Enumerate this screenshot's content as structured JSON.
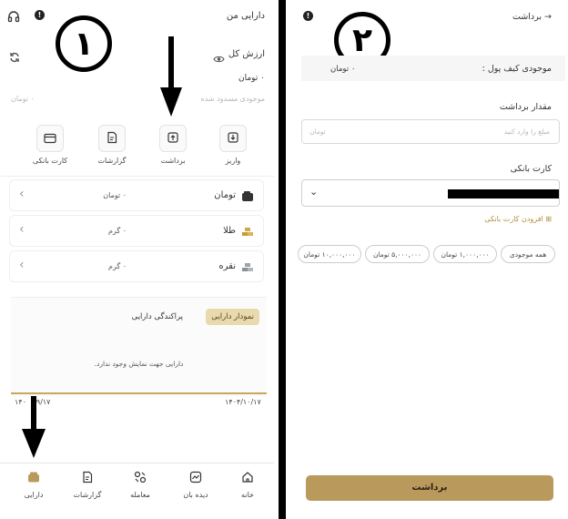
{
  "left": {
    "header_title": "دارایی من",
    "total_label": "ارزش کل",
    "total_value": "۰ تومان",
    "blocked_label": "موجودی مسدود شده",
    "blocked_value": "۰ تومان",
    "actions": [
      {
        "label": "واریز",
        "icon": "download-icon"
      },
      {
        "label": "برداشت",
        "icon": "upload-icon"
      },
      {
        "label": "گزارشات",
        "icon": "report-icon"
      },
      {
        "label": "کارت بانکی",
        "icon": "bank-card-icon"
      }
    ],
    "assets": [
      {
        "name": "تومان",
        "value": "۰ تومان",
        "icon": "wallet-icon"
      },
      {
        "name": "طلا",
        "value": "۰ گرم",
        "icon": "gold-icon"
      },
      {
        "name": "نقره",
        "value": "۰ گرم",
        "icon": "silver-icon"
      }
    ],
    "chart_tab_active": "نمودار دارایی",
    "chart_tab": "پراکندگی دارایی",
    "chart_empty": "دارایی جهت نمایش وجود ندارد.",
    "date_start": "۱۴۰۴/۰۹/۱۷",
    "date_end": "۱۴۰۴/۱۰/۱۷",
    "date_start_visible": "۱۴۰",
    "date_start_tail": "۹/۱۷",
    "nav": [
      "خانه",
      "دیده بان",
      "معامله",
      "گزارشات",
      "دارایی"
    ],
    "circle_number": "۱"
  },
  "right": {
    "header_title": "برداشت",
    "wallet_label": "موجودی کیف پول :",
    "wallet_value": "۰ تومان",
    "amount_label": "مقدار برداشت",
    "amount_placeholder": "تومان",
    "amount_hint": "مبلغ را وارد کنید",
    "card_label": "کارت بانکی",
    "add_card": "افزودن کارت بانکی",
    "chips": [
      "همه موجودی",
      "۱,۰۰۰,۰۰۰ تومان",
      "۵,۰۰۰,۰۰۰ تومان",
      "۱۰,۰۰۰,۰۰۰ تومان"
    ],
    "submit": "برداشت",
    "circle_number": "۲"
  },
  "colors": {
    "accent": "#b99a5c",
    "accent_light": "#eadcb6",
    "divider": "#000000"
  }
}
